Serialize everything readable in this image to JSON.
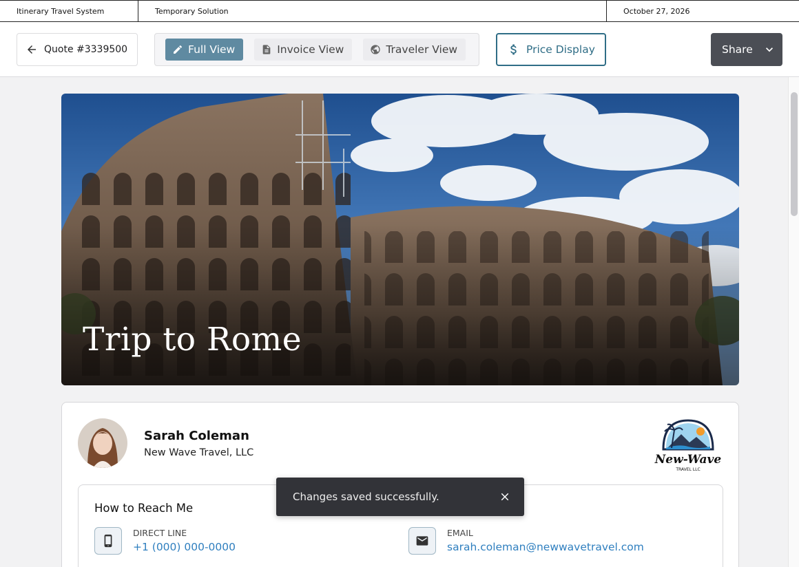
{
  "system_bar": {
    "app_name": "Itinerary Travel System",
    "note": "Temporary Solution",
    "date": "October 27, 2026"
  },
  "toolbar": {
    "back_icon": "arrow-left-icon",
    "quote_label": "Quote #3339500",
    "views": [
      {
        "label": "Full View",
        "icon": "pencil-icon",
        "active": true
      },
      {
        "label": "Invoice View",
        "icon": "document-icon",
        "active": false
      },
      {
        "label": "Traveler View",
        "icon": "globe-icon",
        "active": false
      }
    ],
    "price_label": "Price Display",
    "price_icon": "dollar-icon",
    "share_label": "Share",
    "share_icon": "chevron-down-icon"
  },
  "hero": {
    "title": "Trip to Rome"
  },
  "agent": {
    "name": "Sarah Coleman",
    "company": "New Wave Travel, LLC",
    "logo_text": "New-Wave",
    "logo_subtext": "TRAVEL LLC"
  },
  "reach": {
    "title": "How to Reach Me",
    "phone_label": "DIRECT LINE",
    "phone_value": "+1 (000) 000-0000",
    "email_label": "EMAIL",
    "email_value": "sarah.coleman@newwavetravel.com"
  },
  "snackbar": {
    "message": "Changes saved successfully."
  },
  "colors": {
    "accent": "#5f8aa1",
    "price_border": "#2f6d86",
    "share_bg": "#4b4e55",
    "link": "#2f7fbf",
    "snackbar_bg": "#323338"
  }
}
